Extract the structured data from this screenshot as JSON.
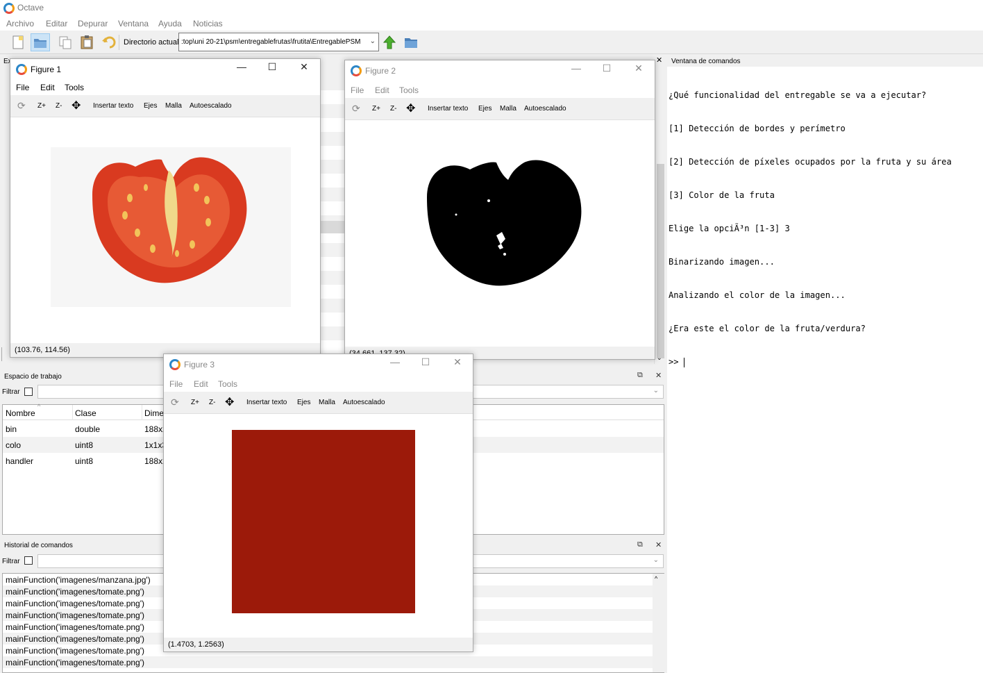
{
  "app": {
    "title": "Octave",
    "menu": [
      "Archivo",
      "Editar",
      "Depurar",
      "Ventana",
      "Ayuda",
      "Noticias"
    ]
  },
  "toolbar": {
    "dir_label": "Directorio actual:",
    "dir_value": ":top\\uni 20-21\\psm\\entregablefrutas\\frutita\\EntregablePSM"
  },
  "workspace": {
    "title": "Espacio de trabajo",
    "filter_label": "Filtrar",
    "columns": [
      "Nombre",
      "Clase",
      "Dime"
    ],
    "rows": [
      {
        "name": "bin",
        "class": "double",
        "dim": "188x2"
      },
      {
        "name": "colo",
        "class": "uint8",
        "dim": "1x1x3"
      },
      {
        "name": "handler",
        "class": "uint8",
        "dim": "188x2"
      }
    ]
  },
  "history": {
    "title": "Historial de comandos",
    "filter_label": "Filtrar",
    "lines": [
      "mainFunction('imagenes/manzana.jpg')",
      "mainFunction('imagenes/tomate.png')",
      "mainFunction('imagenes/tomate.png')",
      "mainFunction('imagenes/tomate.png')",
      "mainFunction('imagenes/tomate.png')",
      "mainFunction('imagenes/tomate.png')",
      "mainFunction('imagenes/tomate.png')",
      "mainFunction('imagenes/tomate.png')"
    ]
  },
  "command_window": {
    "title": "Ventana de comandos",
    "lines": [
      "¿Qué funcionalidad del entregable se va a ejecutar?",
      "[1] Detección de bordes y perímetro",
      "[2] Detección de píxeles ocupados por la fruta y su área",
      "[3] Color de la fruta",
      "Elige la opciÃ³n [1-3] 3",
      "Binarizando imagen...",
      "Analizando el color de la imagen...",
      "¿Era este el color de la fruta/verdura?",
      ">> "
    ]
  },
  "figure_menu": [
    "File",
    "Edit",
    "Tools"
  ],
  "figure_tools": [
    "Z+",
    "Z-",
    "Insertar texto",
    "Ejes",
    "Malla",
    "Autoescalado"
  ],
  "figures": [
    {
      "title": "Figure 1",
      "status": "(103.76, 114.56)"
    },
    {
      "title": "Figure 2",
      "status": "(34.661, 137.32)"
    },
    {
      "title": "Figure 3",
      "status": "(1.4703, 1.2563)"
    }
  ],
  "colors": {
    "fruit_color_swatch": "#9c1a0a",
    "tomato": "#d93a20"
  },
  "hidden_panel": {
    "truncated_label": "Ex"
  }
}
